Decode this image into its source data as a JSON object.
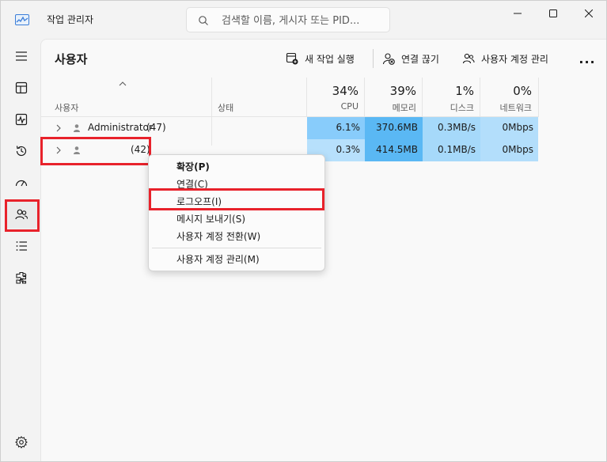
{
  "window": {
    "title": "작업 관리자",
    "search_placeholder": "검색할 이름, 게시자 또는 PID..."
  },
  "sidebar": {
    "items": [
      {
        "name": "hamburger-menu",
        "icon": "menu-icon"
      },
      {
        "name": "processes",
        "icon": "processes-icon"
      },
      {
        "name": "performance",
        "icon": "performance-icon"
      },
      {
        "name": "app-history",
        "icon": "history-icon"
      },
      {
        "name": "startup-apps",
        "icon": "startup-icon"
      },
      {
        "name": "users",
        "icon": "users-icon",
        "active": true
      },
      {
        "name": "details",
        "icon": "details-icon"
      },
      {
        "name": "services",
        "icon": "services-icon"
      },
      {
        "name": "settings",
        "icon": "gear-icon"
      }
    ]
  },
  "page": {
    "title": "사용자"
  },
  "toolbar": {
    "run_new_task": "새 작업 실행",
    "disconnect": "연결 끊기",
    "manage_accounts": "사용자 계정 관리",
    "more": "..."
  },
  "table": {
    "headers": {
      "user": "사용자",
      "status": "상태",
      "cpu_pct": "34%",
      "cpu": "CPU",
      "mem_pct": "39%",
      "mem": "메모리",
      "disk_pct": "1%",
      "disk": "디스크",
      "net_pct": "0%",
      "net": "네트워크"
    },
    "rows": [
      {
        "name": "Administrator",
        "count": "(47)",
        "status": "",
        "cpu": "6.1%",
        "mem": "370.6MB",
        "disk": "0.3MB/s",
        "net": "0Mbps"
      },
      {
        "name": "",
        "count": "(42)",
        "status": "",
        "cpu": "0.3%",
        "mem": "414.5MB",
        "disk": "0.1MB/s",
        "net": "0Mbps"
      }
    ]
  },
  "context_menu": {
    "items": [
      {
        "label": "확장(P)",
        "bold": true
      },
      {
        "label": "연결(C)"
      },
      {
        "label": "로그오프(I)"
      },
      {
        "label": "메시지 보내기(S)"
      },
      {
        "label": "사용자 계정 전환(W)"
      },
      {
        "label": "사용자 계정 관리(M)"
      }
    ]
  },
  "colors": {
    "accent": "#005fb8",
    "highlight_red": "#e8222b",
    "cpu_row1": "#88ccfb",
    "cpu_row2": "#b7e0fc",
    "mem_cell": "#5ab8f4",
    "disk_cell": "#a6d9fa",
    "net_cell": "#b3defb"
  }
}
